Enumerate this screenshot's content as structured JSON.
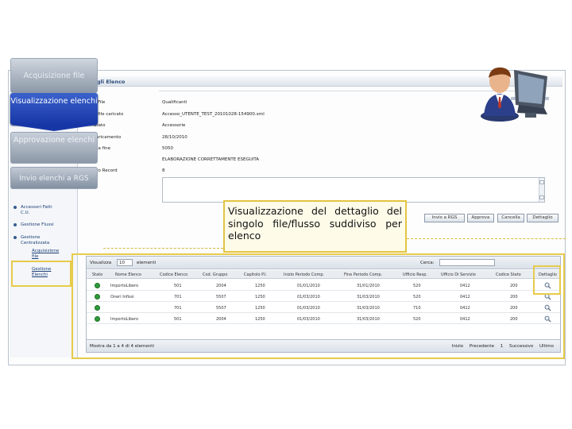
{
  "colors": {
    "step_active": "#1f3fb0",
    "step_inactive": "#95a1b0",
    "highlight": "#e7cb4a",
    "status_ok": "#2f9d3a"
  },
  "steps": [
    {
      "label": "Acquisizione file",
      "state": "inactive"
    },
    {
      "label": "Visualizzazione elenchi",
      "state": "active"
    },
    {
      "label": "Approvazione elenchi",
      "state": "inactive"
    },
    {
      "label": "Invio elenchi a RGS",
      "state": "inactive"
    }
  ],
  "page": {
    "header": "gli Elenco"
  },
  "detail": {
    "labels": [
      "o File",
      "o file caricato",
      "Stato",
      "caricamento",
      "ata fine",
      "ero Record"
    ],
    "values": [
      "Qualificanti",
      "Accesso_UTENTE_TEST_20101028-154900.xml",
      "Accessorie",
      "28/10/2010",
      "5050",
      "ELABORAZIONE CORRETTAMENTE ESEGUITA",
      "8"
    ]
  },
  "sidebar": {
    "items": [
      "Accessori Fatti",
      "C.U.",
      "Gestione Flussi",
      "Gestione",
      "Centralizzata",
      "Acquisizione",
      "file",
      "Gestione",
      "Elenchi"
    ]
  },
  "actions": [
    "Invio a RGS",
    "Approva",
    "Cancella",
    "Dettaglio"
  ],
  "callout": {
    "text": "Visualizzazione del dettaglio del singolo file/flusso suddiviso per elenco"
  },
  "table": {
    "show_label": "Visualizza",
    "page_size": "10",
    "elements_label": "elementi",
    "search_label": "Cerca:",
    "columns": [
      "Stato",
      "Nome Elenco",
      "Codice Elenco",
      "Cod. Gruppo",
      "Capitolo P.I.",
      "Inizio Periodo Comp.",
      "Fine Periodo Comp.",
      "Ufficio Resp.",
      "Ufficio Di Servizio",
      "Codice Stato",
      "Dettaglio"
    ],
    "rows": [
      [
        "",
        "ImportoLibero",
        "501",
        "2004",
        "1250",
        "01/01/2010",
        "31/01/2010",
        "520",
        "0412",
        "200"
      ],
      [
        "",
        "Oneri Infissi",
        "701",
        "5507",
        "1250",
        "01/03/2010",
        "31/03/2010",
        "520",
        "0412",
        "200"
      ],
      [
        "",
        "",
        "701",
        "5507",
        "1250",
        "01/03/2010",
        "31/03/2010",
        "710",
        "0412",
        "200"
      ],
      [
        "",
        "ImportoLibero",
        "501",
        "2004",
        "1250",
        "01/03/2010",
        "31/03/2010",
        "520",
        "0412",
        "200"
      ]
    ],
    "footer_info": "Mostra da 1 a 4 di 4 elementi",
    "pager": [
      "Inizio",
      "Precedente",
      "1",
      "Successivo",
      "Ultimo"
    ]
  }
}
